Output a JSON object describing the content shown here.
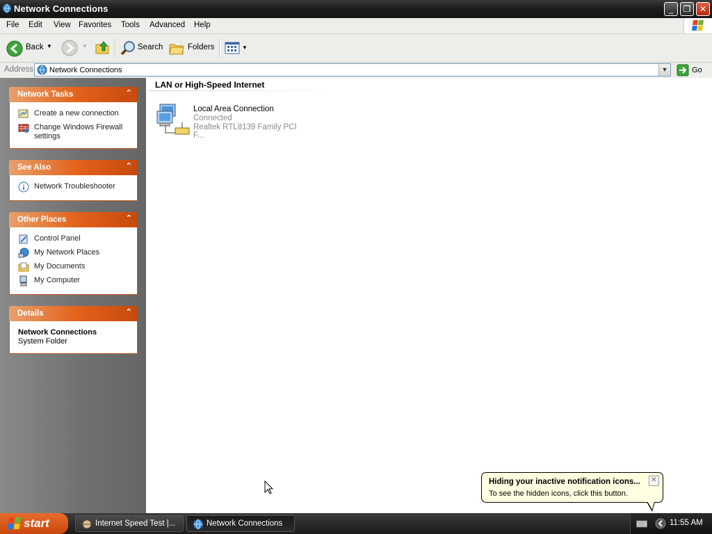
{
  "window": {
    "title": "Network Connections",
    "controls": [
      "minimize",
      "restore",
      "close"
    ]
  },
  "menubar": {
    "items": [
      "File",
      "Edit",
      "View",
      "Favorites",
      "Tools",
      "Advanced",
      "Help"
    ]
  },
  "toolbar": {
    "back_label": "Back",
    "search_label": "Search",
    "folders_label": "Folders"
  },
  "address": {
    "label": "Address",
    "value": "Network Connections",
    "go_label": "Go"
  },
  "sidebar": {
    "network_tasks": {
      "title": "Network Tasks",
      "items": [
        "Create a new connection",
        "Change Windows Firewall settings"
      ]
    },
    "see_also": {
      "title": "See Also",
      "items": [
        "Network Troubleshooter"
      ]
    },
    "other_places": {
      "title": "Other Places",
      "items": [
        "Control Panel",
        "My Network Places",
        "My Documents",
        "My Computer"
      ]
    },
    "details": {
      "title": "Details",
      "name": "Network Connections",
      "type": "System Folder"
    }
  },
  "content": {
    "section_title": "LAN or High-Speed Internet",
    "connection": {
      "name": "Local Area Connection",
      "status": "Connected",
      "adapter": "Realtek RTL8139 Family PCI F..."
    }
  },
  "balloon": {
    "title": "Hiding your inactive notification icons...",
    "text": "To see the hidden icons, click this button."
  },
  "taskbar": {
    "start_label": "start",
    "tasks": [
      "Internet Speed Test |...",
      "Network Connections"
    ],
    "clock": "11:55 AM"
  },
  "colors": {
    "panel_header": "#e26019",
    "sidebar_bg": "#777777",
    "taskbar": "#1b1b1b"
  }
}
